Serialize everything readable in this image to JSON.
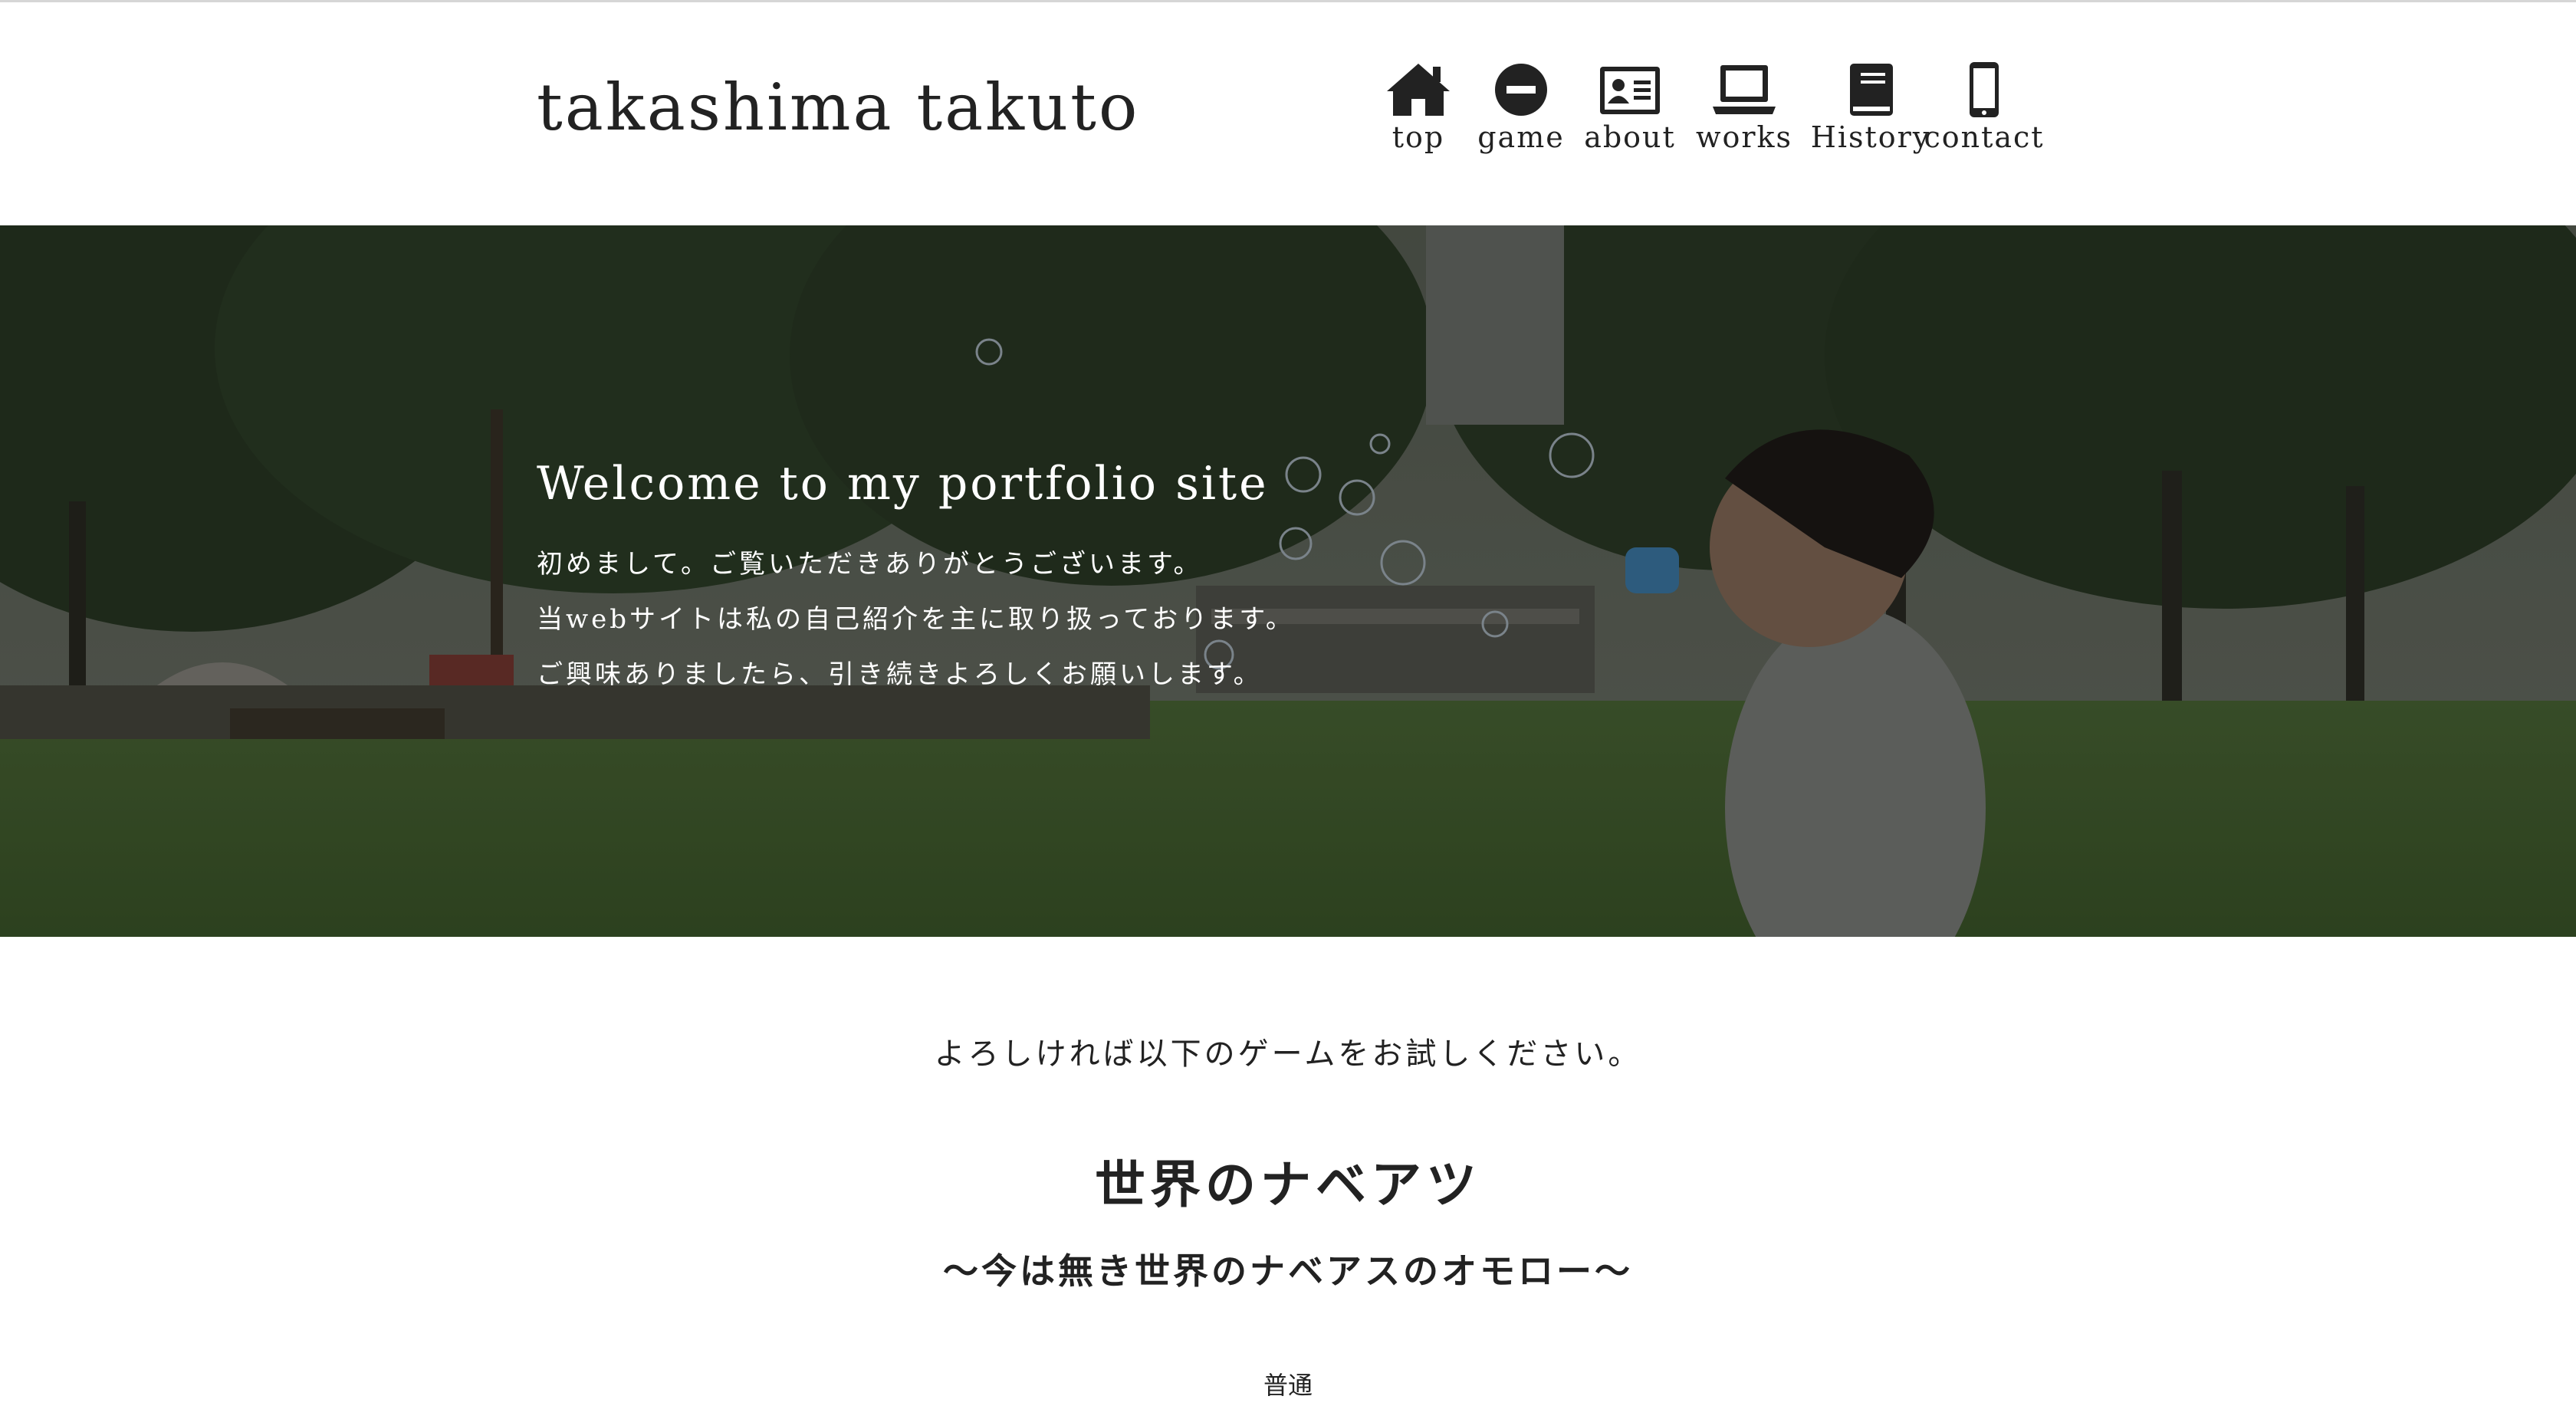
{
  "header": {
    "site_title": "takashima takuto"
  },
  "nav": {
    "items": [
      {
        "label": "top",
        "icon": "home-icon"
      },
      {
        "label": "game",
        "icon": "minus-circle-icon"
      },
      {
        "label": "about",
        "icon": "id-card-icon"
      },
      {
        "label": "works",
        "icon": "laptop-icon"
      },
      {
        "label": "History",
        "icon": "book-icon"
      },
      {
        "label": "contact",
        "icon": "mobile-phone-icon"
      }
    ]
  },
  "hero": {
    "title": "Welcome to my portfolio site",
    "lines": [
      "初めまして。ご覧いただきありがとうございます。",
      "当webサイトは私の自己紹介を主に取り扱っております。",
      "ご興味ありましたら、引き続きよろしくお願いします。"
    ]
  },
  "content": {
    "intro": "よろしければ以下のゲームをお試しください。",
    "game_title": "世界のナベアツ",
    "game_subtitle": "〜今は無き世界のナベアスのオモロー〜",
    "difficulty": "普通"
  },
  "colors": {
    "text": "#222222",
    "hero_text": "#ffffff",
    "background": "#ffffff",
    "hero_grass": "#4f6b3a",
    "hero_trees": "#2c3a26"
  }
}
